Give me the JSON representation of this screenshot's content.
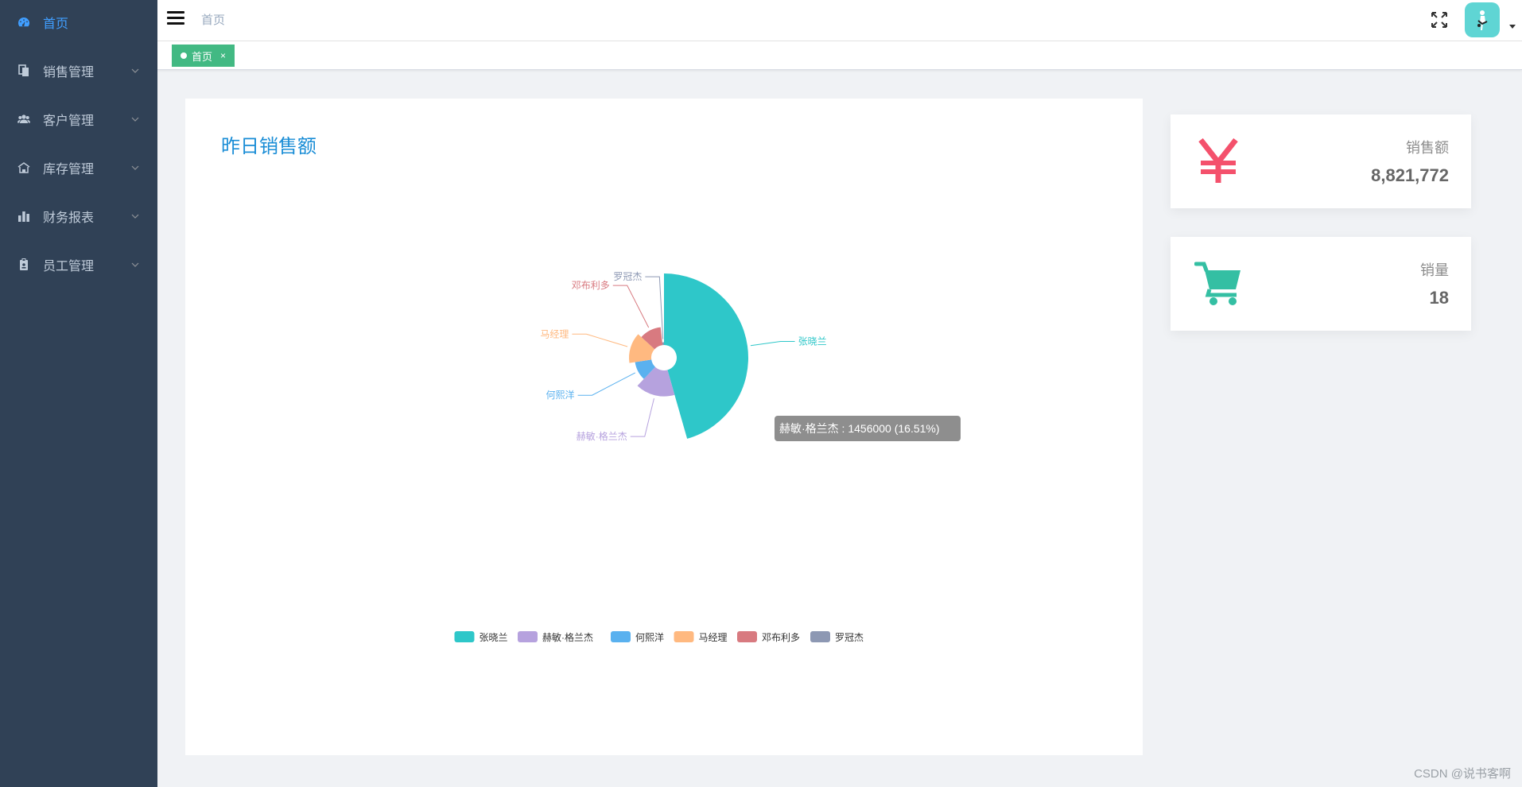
{
  "sidebar": {
    "items": [
      {
        "label": "首页",
        "icon": "dashboard-icon",
        "active": true
      },
      {
        "label": "销售管理",
        "icon": "documents-icon"
      },
      {
        "label": "客户管理",
        "icon": "users-icon"
      },
      {
        "label": "库存管理",
        "icon": "warehouse-icon"
      },
      {
        "label": "财务报表",
        "icon": "bar-chart-icon"
      },
      {
        "label": "员工管理",
        "icon": "badge-icon"
      }
    ]
  },
  "header": {
    "breadcrumb": "首页"
  },
  "tags": [
    {
      "label": "首页",
      "close": "×"
    }
  ],
  "chart_title": "昨日销售额",
  "chart_data": {
    "type": "pie",
    "variant": "rose",
    "title": "昨日销售额",
    "series": [
      {
        "name": "张晓兰",
        "value": 4020000,
        "color": "#2ec7c9"
      },
      {
        "name": "赫敏·格兰杰",
        "value": 1456000,
        "color": "#b6a2de"
      },
      {
        "name": "何熙洋",
        "value": 930000,
        "color": "#5ab1ef"
      },
      {
        "name": "马经理",
        "value": 1250000,
        "color": "#ffb980"
      },
      {
        "name": "邓布利多",
        "value": 1010000,
        "color": "#d87a80"
      },
      {
        "name": "罗冠杰",
        "value": 155772,
        "color": "#8d98b3"
      }
    ],
    "legend_position": "bottom",
    "tooltip": "赫敏·格兰杰 : 1456000 (16.51%)"
  },
  "stats": {
    "sales": {
      "label": "销售额",
      "value": "8,821,772",
      "icon": "yen-icon",
      "color": "#f4516c"
    },
    "quantity": {
      "label": "销量",
      "value": "18",
      "icon": "cart-icon",
      "color": "#34bfa3"
    }
  },
  "watermark": "CSDN @说书客啊"
}
